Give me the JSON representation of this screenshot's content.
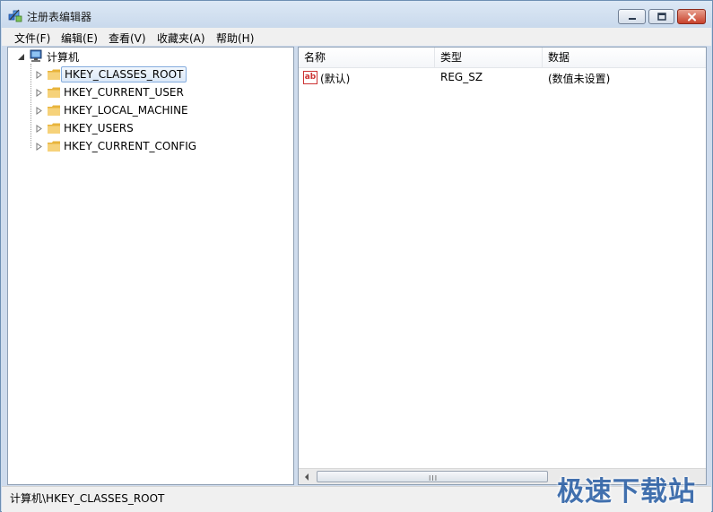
{
  "window": {
    "title": "注册表编辑器"
  },
  "menu": [
    {
      "label": "文件(F)"
    },
    {
      "label": "编辑(E)"
    },
    {
      "label": "查看(V)"
    },
    {
      "label": "收藏夹(A)"
    },
    {
      "label": "帮助(H)"
    }
  ],
  "tree": {
    "root": "计算机",
    "children": [
      {
        "label": "HKEY_CLASSES_ROOT",
        "selected": true
      },
      {
        "label": "HKEY_CURRENT_USER",
        "selected": false
      },
      {
        "label": "HKEY_LOCAL_MACHINE",
        "selected": false
      },
      {
        "label": "HKEY_USERS",
        "selected": false
      },
      {
        "label": "HKEY_CURRENT_CONFIG",
        "selected": false
      }
    ]
  },
  "list": {
    "columns": [
      "名称",
      "类型",
      "数据"
    ],
    "rows": [
      {
        "icon": "string-value-icon",
        "icon_text": "ab",
        "name": "(默认)",
        "type": "REG_SZ",
        "data": "(数值未设置)"
      }
    ]
  },
  "scrollbar": {
    "grip": "III"
  },
  "status": {
    "path": "计算机\\HKEY_CLASSES_ROOT"
  },
  "watermark": {
    "text": "极速下载站"
  },
  "colors": {
    "accent": "#84acdd",
    "folder": "#f3c85a",
    "close": "#c8422c",
    "watermark": "#2a5fa5"
  }
}
